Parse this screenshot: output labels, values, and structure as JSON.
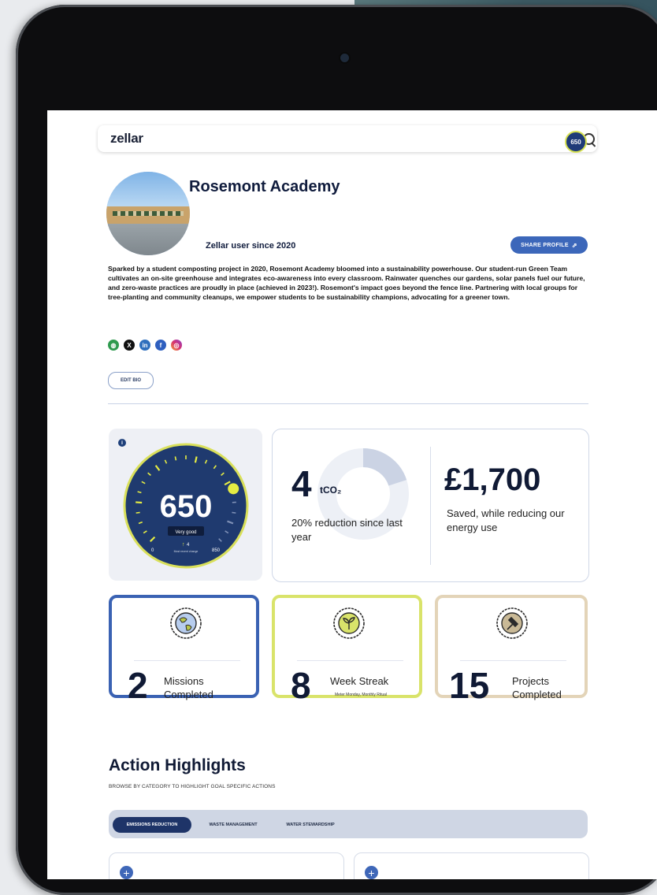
{
  "nav": {
    "logo": "zellar",
    "score_badge": "650"
  },
  "profile": {
    "name": "Rosemont Academy",
    "since": "Zellar user since 2020",
    "share_label": "SHARE PROFILE",
    "bio": "Sparked by a student composting project in 2020, Rosemont Academy bloomed into a sustainability powerhouse. Our student-run Green Team cultivates an on-site greenhouse and integrates eco-awareness into every classroom. Rainwater quenches our gardens, solar panels fuel our future, and zero-waste practices are proudly in place (achieved in 2023!). Rosemont's impact goes beyond the fence line. Partnering with local groups for tree-planting and community cleanups, we empower students to be sustainability champions, advocating for a greener town.",
    "edit_bio_label": "EDIT BIO",
    "socials": [
      "web-icon",
      "x-icon",
      "linkedin-icon",
      "facebook-icon",
      "instagram-icon"
    ]
  },
  "gauge": {
    "score": "650",
    "rating": "Very good",
    "min": "0",
    "max": "850",
    "change": "4",
    "change_label": "Most recent change",
    "value_fraction": 0.76
  },
  "emissions": {
    "value": "4",
    "unit": "tCO₂",
    "text": "20% reduction since last year",
    "reduction_fraction": 0.2
  },
  "savings": {
    "value": "£1,700",
    "text": "Saved, while reducing our energy use"
  },
  "stats": [
    {
      "num": "2",
      "label": "Missions Completed",
      "sub": "",
      "badge": "globe-icon",
      "color": "#3a62b3"
    },
    {
      "num": "8",
      "label": "Week Streak",
      "sub": "Meter Monday, Monthly Ritual",
      "badge": "sprout-icon",
      "color": "#d9e36a"
    },
    {
      "num": "15",
      "label": "Projects Completed",
      "sub": "",
      "badge": "hammer-icon",
      "color": "#e3d4b8"
    }
  ],
  "actions": {
    "title": "Action Highlights",
    "subtitle": "BROWSE  BY CATEGORY TO HIGHLIGHT GOAL SPECIFIC ACTIONS",
    "tabs": [
      "EMISSIONS REDUCTION",
      "WASTE MANAGEMENT",
      "WATER STEWARDSHIP"
    ]
  }
}
